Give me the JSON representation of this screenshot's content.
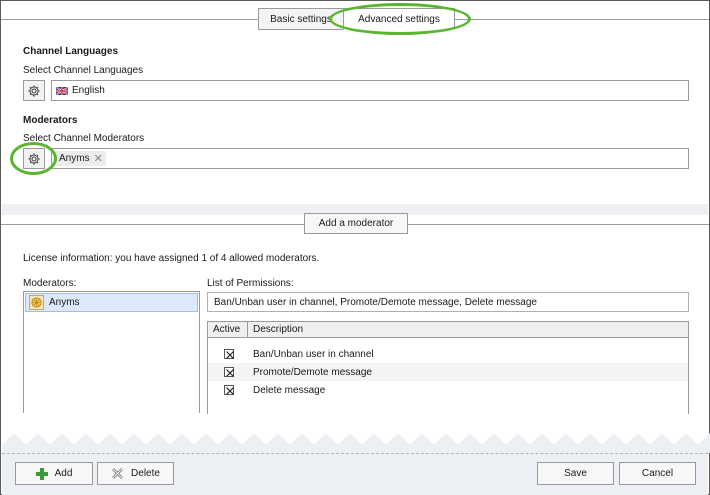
{
  "tabs": [
    {
      "label": "Basic settings",
      "active": false
    },
    {
      "label": "Advanced settings",
      "active": true
    }
  ],
  "languages": {
    "title": "Channel Languages",
    "label": "Select Channel Languages",
    "selected": "English",
    "flag_icon": "uk-flag-icon"
  },
  "moderators_section": {
    "title": "Moderators",
    "label": "Select Channel Moderators",
    "tokens": [
      "Anyms"
    ]
  },
  "add_moderator_label": "Add a moderator",
  "license_text": "License information: you have assigned 1 of 4 allowed moderators.",
  "moderators_list": {
    "label": "Moderators:",
    "items": [
      "Anyms"
    ]
  },
  "permissions": {
    "label": "List of Permissions:",
    "summary": "Ban/Unban user in channel, Promote/Demote message, Delete message",
    "columns": [
      "Active",
      "Description"
    ],
    "rows": [
      {
        "active": true,
        "description": "Ban/Unban user in channel"
      },
      {
        "active": true,
        "description": "Promote/Demote message"
      },
      {
        "active": true,
        "description": "Delete message"
      }
    ]
  },
  "footer": {
    "add_label": "Add",
    "delete_label": "Delete",
    "save_label": "Save",
    "cancel_label": "Cancel"
  },
  "colors": {
    "highlight": "#5cb531",
    "selection": "#dbe9fb",
    "add_icon": "#3a9a3a"
  }
}
